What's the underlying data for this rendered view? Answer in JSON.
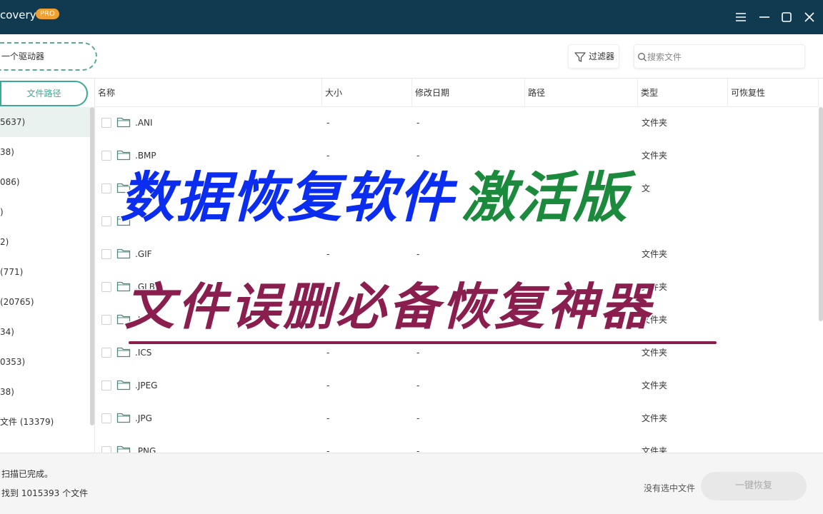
{
  "titlebar": {
    "app_title": "covery",
    "badge": "PRO",
    "accent_color": "#0f3a4f",
    "badge_color": "#f0a030"
  },
  "toolbar": {
    "drive_selector_label": "一个驱动器",
    "filter_label": "过滤器",
    "search_placeholder": "搜索文件"
  },
  "sidebar": {
    "path_tab_label": "文件路径",
    "items": [
      {
        "label": "5637)"
      },
      {
        "label": "38)"
      },
      {
        "label": "086)"
      },
      {
        "label": ")"
      },
      {
        "label": "2)"
      },
      {
        "label": "(771)"
      },
      {
        "label": "(20765)"
      },
      {
        "label": "34)"
      },
      {
        "label": "0353)"
      },
      {
        "label": "38)"
      },
      {
        "label": "文件 (13379)"
      }
    ]
  },
  "table": {
    "columns": [
      "名称",
      "大小",
      "修改日期",
      "路径",
      "类型",
      "可恢复性"
    ],
    "rows": [
      {
        "name": ".ANI",
        "size": "-",
        "date": "-",
        "path": "",
        "type": "文件夹",
        "recoverability": ""
      },
      {
        "name": ".BMP",
        "size": "-",
        "date": "-",
        "path": "",
        "type": "文件夹",
        "recoverability": ""
      },
      {
        "name": "",
        "size": "",
        "date": "",
        "path": "",
        "type": "文",
        "recoverability": ""
      },
      {
        "name": "",
        "size": "",
        "date": "",
        "path": "",
        "type": "",
        "recoverability": ""
      },
      {
        "name": ".GIF",
        "size": "-",
        "date": "-",
        "path": "",
        "type": "文件夹",
        "recoverability": ""
      },
      {
        "name": ".GLB",
        "size": "",
        "date": "",
        "path": "",
        "type": "文件夹",
        "recoverability": ""
      },
      {
        "name": ".IC",
        "size": "",
        "date": "",
        "path": "",
        "type": "文件夹",
        "recoverability": ""
      },
      {
        "name": ".ICS",
        "size": "-",
        "date": "-",
        "path": "",
        "type": "文件夹",
        "recoverability": ""
      },
      {
        "name": ".JPEG",
        "size": "-",
        "date": "-",
        "path": "",
        "type": "文件夹",
        "recoverability": ""
      },
      {
        "name": ".JPG",
        "size": "-",
        "date": "-",
        "path": "",
        "type": "文件夹",
        "recoverability": ""
      },
      {
        "name": ".PNG",
        "size": "-",
        "date": "-",
        "path": "",
        "type": "文件夹",
        "recoverability": ""
      }
    ]
  },
  "status": {
    "scan_done": "扫描已完成。",
    "found_text": "找到 1015393 个文件",
    "no_selection": "没有选中文件",
    "recover_label": "一键恢复"
  },
  "overlay": {
    "line1_blue": "数据恢复软件",
    "line1_green": "激活版",
    "line2": "文件误删必备恢复神器"
  },
  "colors": {
    "selection_green": "#3aaa94",
    "overlay_blue": "#0b2df0",
    "overlay_green": "#1c8a3c",
    "overlay_maroon": "#8a1e4e"
  }
}
